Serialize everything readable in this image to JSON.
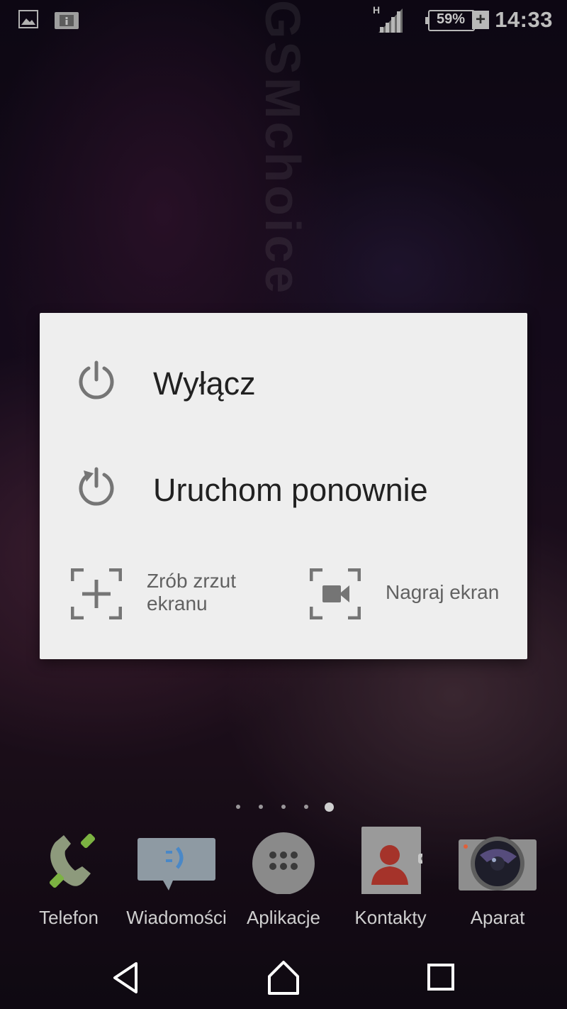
{
  "status_bar": {
    "time": "14:33",
    "battery_percent": "59%",
    "battery_charging_symbol": "+",
    "network_type": "H",
    "left_icons": [
      "image-notification-icon",
      "info-card-notification-icon"
    ],
    "right_icons": [
      "signal-icon",
      "battery-icon"
    ]
  },
  "watermark": "GSMchoice",
  "power_menu": {
    "power_off": {
      "label": "Wyłącz",
      "icon": "power-icon"
    },
    "restart": {
      "label": "Uruchom ponownie",
      "icon": "restart-icon"
    },
    "screenshot": {
      "label_line1": "Zrób zrzut",
      "label_line2": "ekranu",
      "icon": "screenshot-icon"
    },
    "screen_record": {
      "label": "Nagraj ekran",
      "icon": "video-camera-icon"
    }
  },
  "home_pages": {
    "count": 5,
    "active_index": 4
  },
  "dock": [
    {
      "label": "Telefon",
      "icon": "phone-icon"
    },
    {
      "label": "Wiadomości",
      "icon": "messages-icon"
    },
    {
      "label": "Aplikacje",
      "icon": "app-drawer-icon"
    },
    {
      "label": "Kontakty",
      "icon": "contacts-icon"
    },
    {
      "label": "Aparat",
      "icon": "camera-icon"
    }
  ],
  "nav_bar": [
    "back-icon",
    "home-icon",
    "recents-icon"
  ],
  "colors": {
    "dialog_background": "#eeeeee",
    "primary_text": "#212121",
    "secondary_text": "#616161",
    "icon_gray": "#757575"
  }
}
